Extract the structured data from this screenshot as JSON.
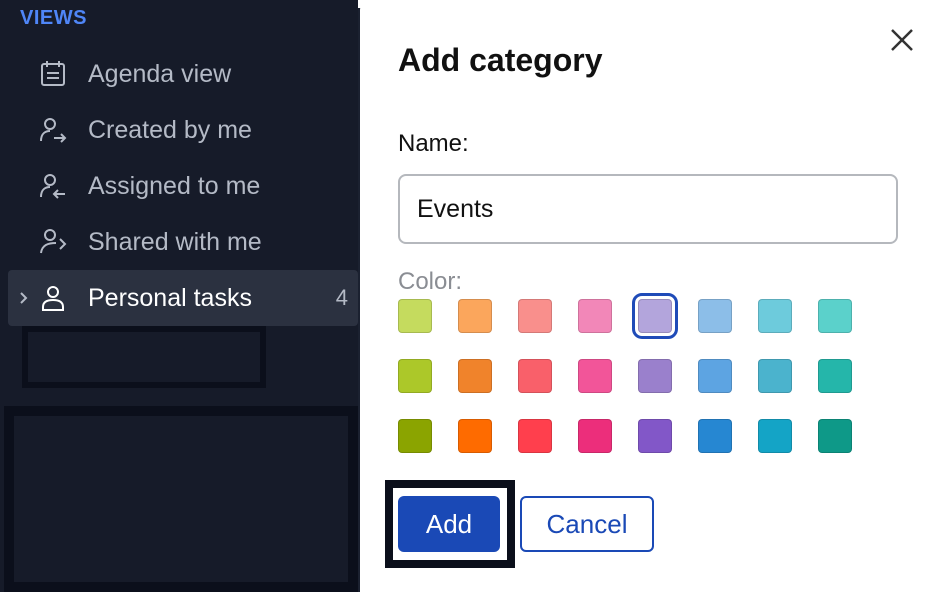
{
  "sidebar": {
    "section_title": "VIEWS",
    "items": [
      {
        "label": "Agenda view",
        "icon": "calendar-list-icon"
      },
      {
        "label": "Created by me",
        "icon": "user-arrow-right-icon"
      },
      {
        "label": "Assigned to me",
        "icon": "user-arrow-left-icon"
      },
      {
        "label": "Shared with me",
        "icon": "share-icon"
      },
      {
        "label": "Personal tasks",
        "icon": "user-icon",
        "count": "4",
        "active": true
      }
    ]
  },
  "dialog": {
    "title": "Add category",
    "name_label": "Name:",
    "name_value": "Events",
    "color_label": "Color:",
    "selected_color": "#b3a5dc",
    "colors": [
      [
        "#c5db5e",
        "#fba65c",
        "#f98f8c",
        "#f287b8",
        "#b3a5dc",
        "#8cbee8",
        "#6dcbdc",
        "#5bd1cb"
      ],
      [
        "#acc829",
        "#f0832b",
        "#f9606a",
        "#f25599",
        "#9a80cc",
        "#5da4e2",
        "#4bb3cd",
        "#25b6aa"
      ],
      [
        "#8ba400",
        "#fe6b00",
        "#ff3f4d",
        "#ec2e7b",
        "#8257c8",
        "#2687d2",
        "#14a4c6",
        "#0e9988"
      ]
    ],
    "add_label": "Add",
    "cancel_label": "Cancel"
  },
  "colors": {
    "accent": "#1a49b6",
    "sidebar_bg": "#161b29",
    "views_heading": "#4f86f7"
  }
}
